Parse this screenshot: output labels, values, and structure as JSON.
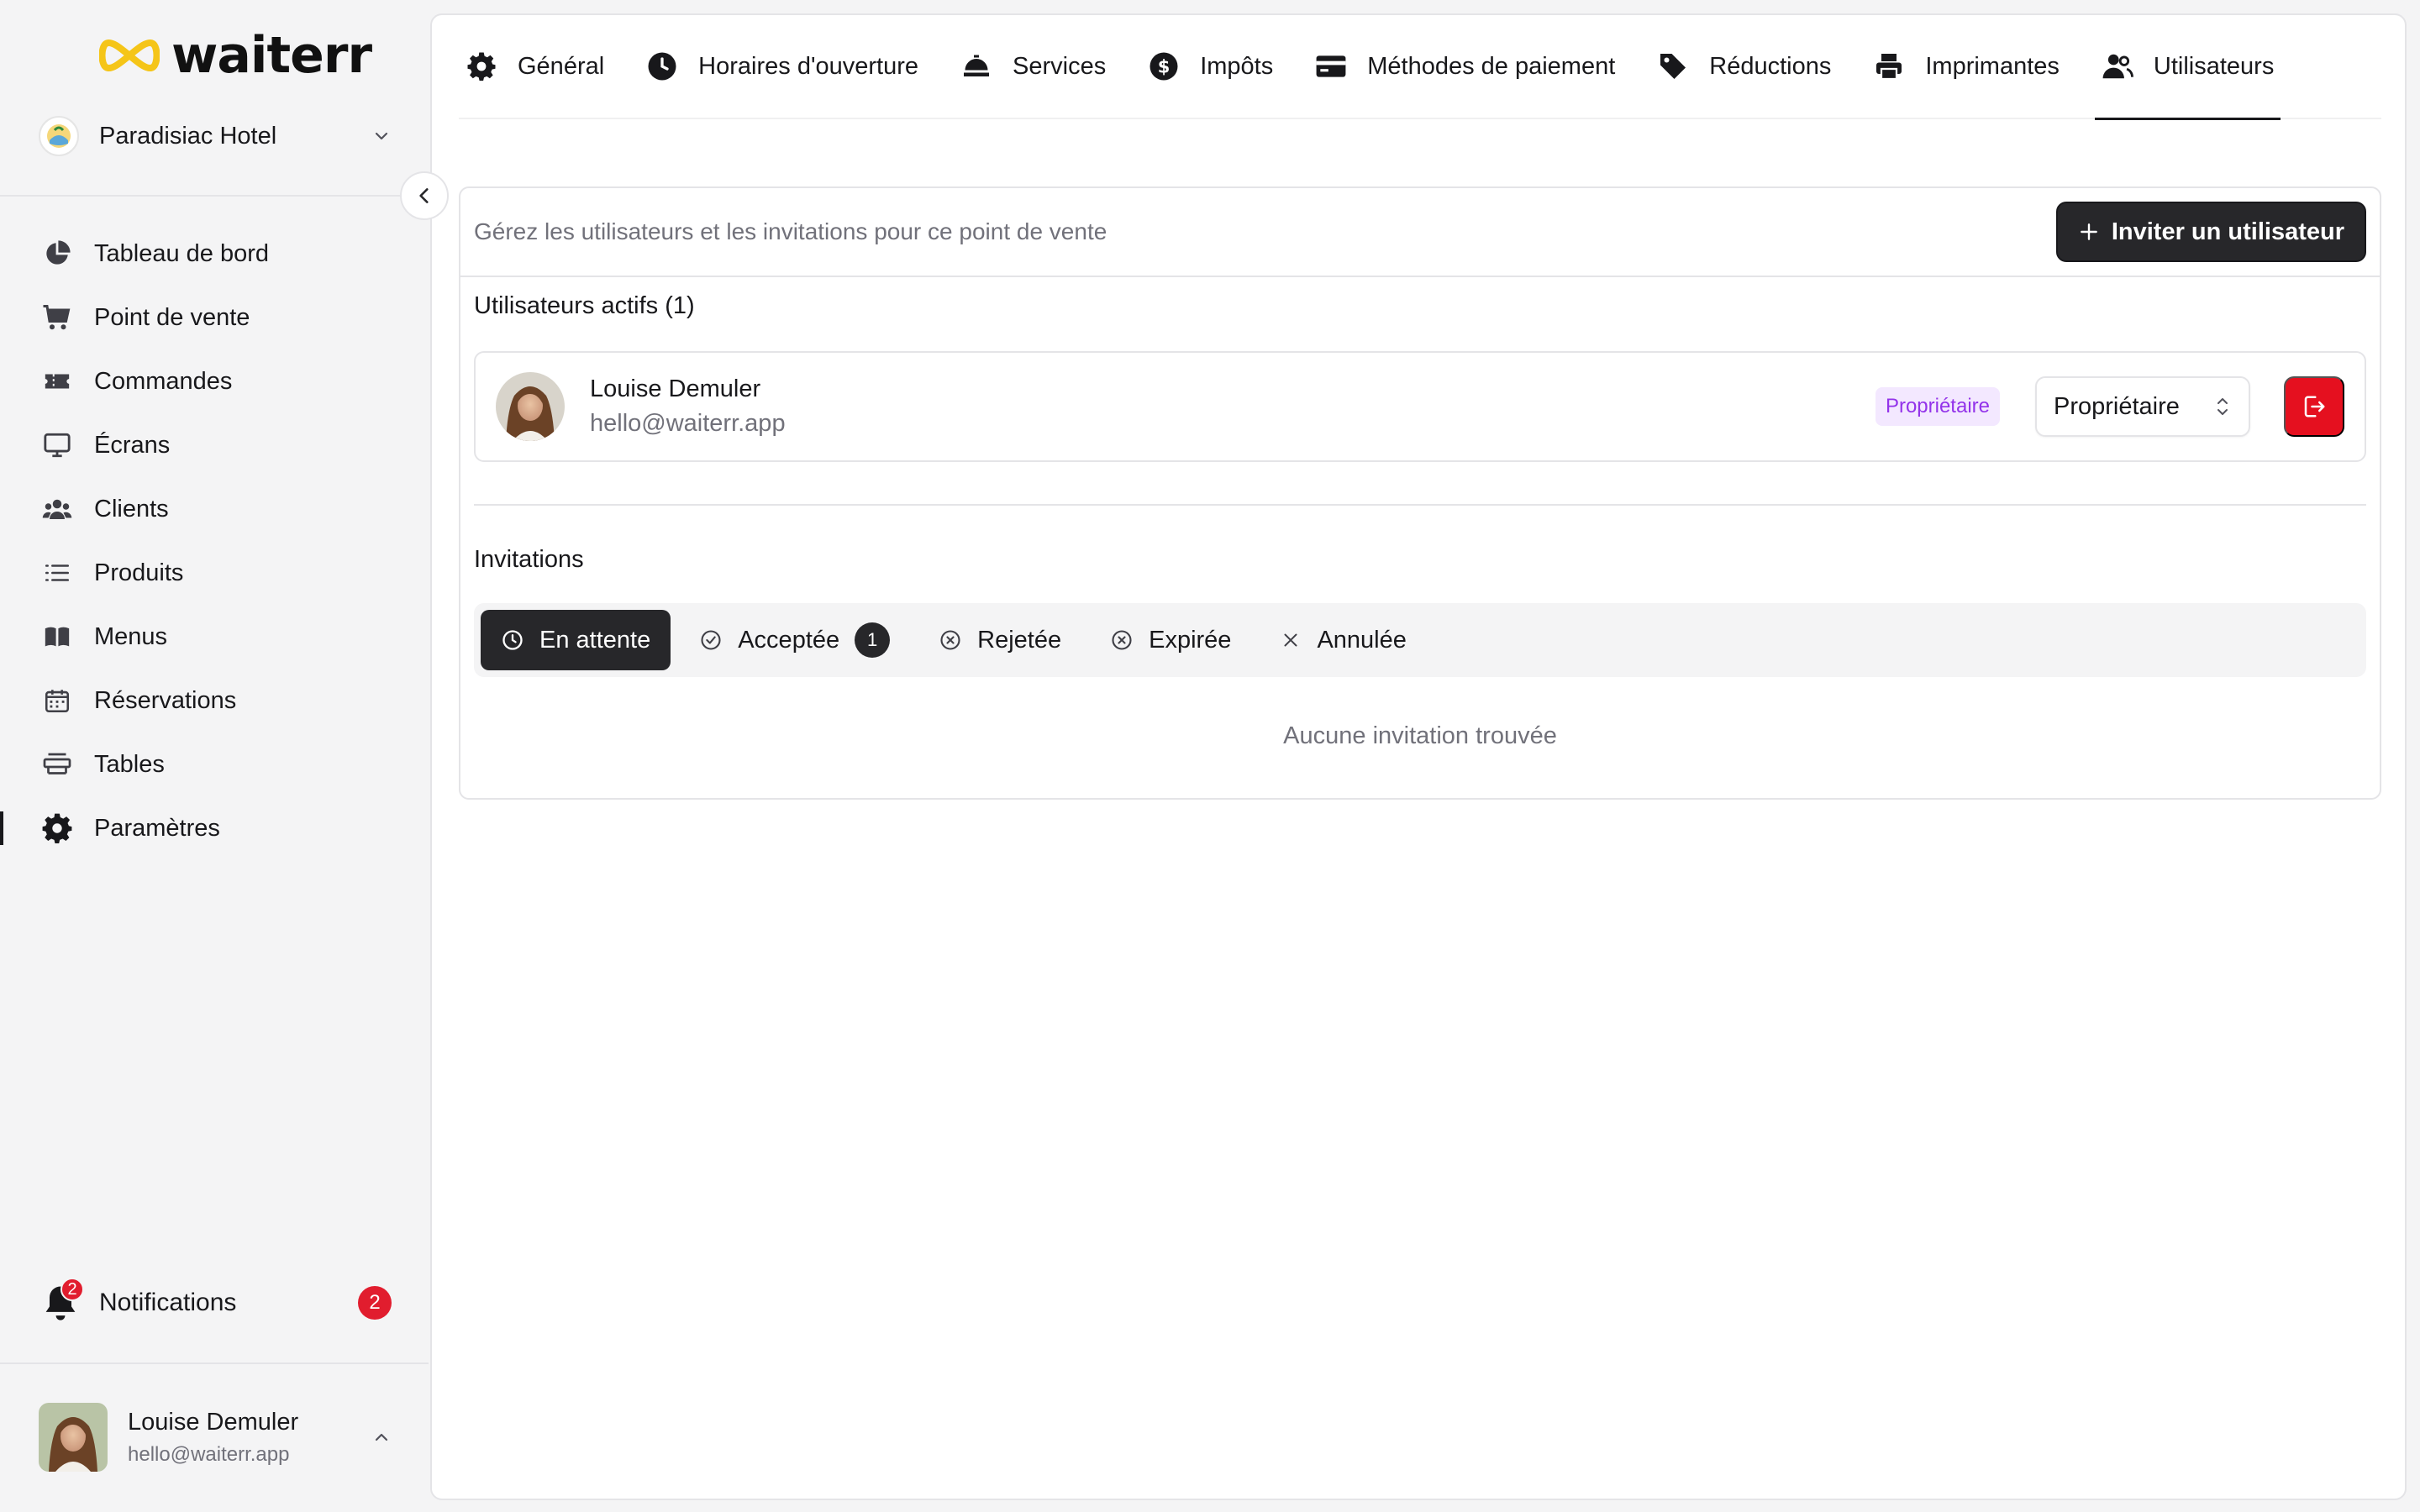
{
  "brand": {
    "name": "waiterr",
    "accent": "#f5c518"
  },
  "store": {
    "name": "Paradisiac Hotel"
  },
  "sidebar": {
    "items": [
      {
        "label": "Tableau de bord",
        "icon": "pie-chart-icon"
      },
      {
        "label": "Point de vente",
        "icon": "cart-icon"
      },
      {
        "label": "Commandes",
        "icon": "ticket-icon"
      },
      {
        "label": "Écrans",
        "icon": "monitor-icon"
      },
      {
        "label": "Clients",
        "icon": "users-icon"
      },
      {
        "label": "Produits",
        "icon": "list-icon"
      },
      {
        "label": "Menus",
        "icon": "book-icon"
      },
      {
        "label": "Réservations",
        "icon": "calendar-icon"
      },
      {
        "label": "Tables",
        "icon": "table-icon"
      },
      {
        "label": "Paramètres",
        "icon": "gear-icon",
        "active": true
      }
    ],
    "notifications": {
      "label": "Notifications",
      "badge": "2",
      "count": "2"
    },
    "profile": {
      "name": "Louise Demuler",
      "email": "hello@waiterr.app"
    }
  },
  "tabs": [
    {
      "label": "Général",
      "icon": "gear-icon"
    },
    {
      "label": "Horaires d'ouverture",
      "icon": "clock-icon"
    },
    {
      "label": "Services",
      "icon": "cloche-icon"
    },
    {
      "label": "Impôts",
      "icon": "dollar-icon"
    },
    {
      "label": "Méthodes de paiement",
      "icon": "credit-card-icon"
    },
    {
      "label": "Réductions",
      "icon": "tag-icon"
    },
    {
      "label": "Imprimantes",
      "icon": "printer-icon"
    },
    {
      "label": "Utilisateurs",
      "icon": "users-icon",
      "active": true
    }
  ],
  "users_page": {
    "description": "Gérez les utilisateurs et les invitations pour ce point de vente",
    "invite_button": "Inviter un utilisateur",
    "active_title": "Utilisateurs actifs (1)",
    "users": [
      {
        "name": "Louise Demuler",
        "email": "hello@waiterr.app",
        "badge": "Propriétaire",
        "role": "Propriétaire"
      }
    ],
    "invitations_title": "Invitations",
    "filters": [
      {
        "label": "En attente",
        "icon": "clock-icon",
        "active": true
      },
      {
        "label": "Acceptée",
        "icon": "check-circle-icon",
        "count": "1"
      },
      {
        "label": "Rejetée",
        "icon": "x-circle-icon"
      },
      {
        "label": "Expirée",
        "icon": "x-circle-icon"
      },
      {
        "label": "Annulée",
        "icon": "x-icon"
      }
    ],
    "empty_text": "Aucune invitation trouvée"
  },
  "colors": {
    "danger": "#e5101f",
    "badge_bg": "#f3e8ff",
    "badge_text": "#9333ea",
    "dark": "#27272a"
  }
}
